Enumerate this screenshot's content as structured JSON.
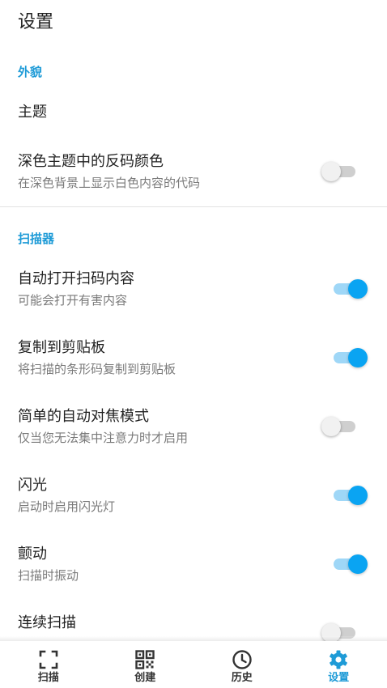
{
  "page": {
    "title": "设置"
  },
  "appearance": {
    "header": "外貌",
    "theme": {
      "title": "主题"
    },
    "inverted": {
      "title": "深色主题中的反码颜色",
      "subtitle": "在深色背景上显示白色内容的代码",
      "enabled": false
    }
  },
  "scanner": {
    "header": "扫描器",
    "items": [
      {
        "title": "自动打开扫码内容",
        "subtitle": "可能会打开有害内容",
        "enabled": true
      },
      {
        "title": "复制到剪贴板",
        "subtitle": "将扫描的条形码复制到剪贴板",
        "enabled": true
      },
      {
        "title": "简单的自动对焦模式",
        "subtitle": "仅当您无法集中注意力时才启用",
        "enabled": false
      },
      {
        "title": "闪光",
        "subtitle": "启动时启用闪光灯",
        "enabled": true
      },
      {
        "title": "颤动",
        "subtitle": "扫描时振动",
        "enabled": true
      },
      {
        "title": "连续扫描",
        "enabled": false
      }
    ]
  },
  "nav": {
    "items": [
      {
        "label": "扫描",
        "icon": "scan-icon"
      },
      {
        "label": "创建",
        "icon": "qr-code-icon"
      },
      {
        "label": "历史",
        "icon": "clock-icon"
      },
      {
        "label": "设置",
        "icon": "gear-icon",
        "active": true
      }
    ]
  },
  "colors": {
    "accent": "#1e9bd7",
    "switch_on": "#0aa4f2",
    "switch_on_track": "#9fd7f7",
    "switch_off_track": "#cfcfcf"
  }
}
